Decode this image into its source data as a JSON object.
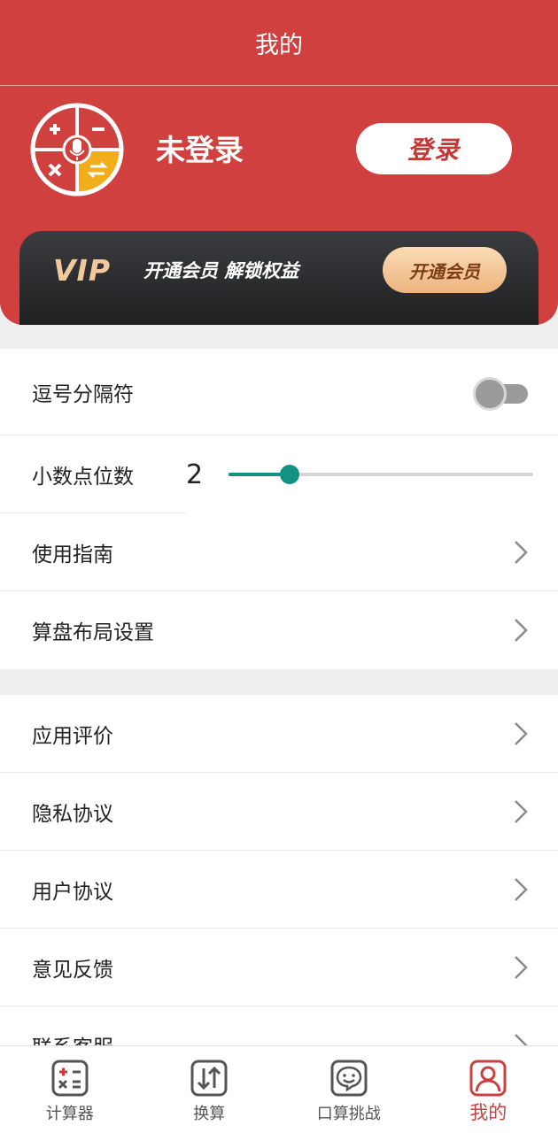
{
  "page": {
    "title": "我的"
  },
  "profile": {
    "status": "未登录",
    "login_label": "登录"
  },
  "vip": {
    "logo": "VIP",
    "slogan": "开通会员 解锁权益",
    "button_label": "开通会员"
  },
  "settings": {
    "comma_separator": {
      "label": "逗号分隔符",
      "enabled": false
    },
    "decimal_places": {
      "label": "小数点位数",
      "value": "2",
      "slider_fraction": 0.2
    },
    "guide": {
      "label": "使用指南"
    },
    "layout": {
      "label": "算盘布局设置"
    }
  },
  "about": {
    "rating": {
      "label": "应用评价"
    },
    "privacy": {
      "label": "隐私协议"
    },
    "user_agreement": {
      "label": "用户协议"
    },
    "feedback": {
      "label": "意见反馈"
    },
    "contact": {
      "label": "联系客服"
    }
  },
  "nav": {
    "calculator": "计算器",
    "convert": "换算",
    "challenge": "口算挑战",
    "mine": "我的",
    "active_color": "#c94240"
  },
  "colors": {
    "brand": "#cf403e",
    "accent": "#139284"
  }
}
